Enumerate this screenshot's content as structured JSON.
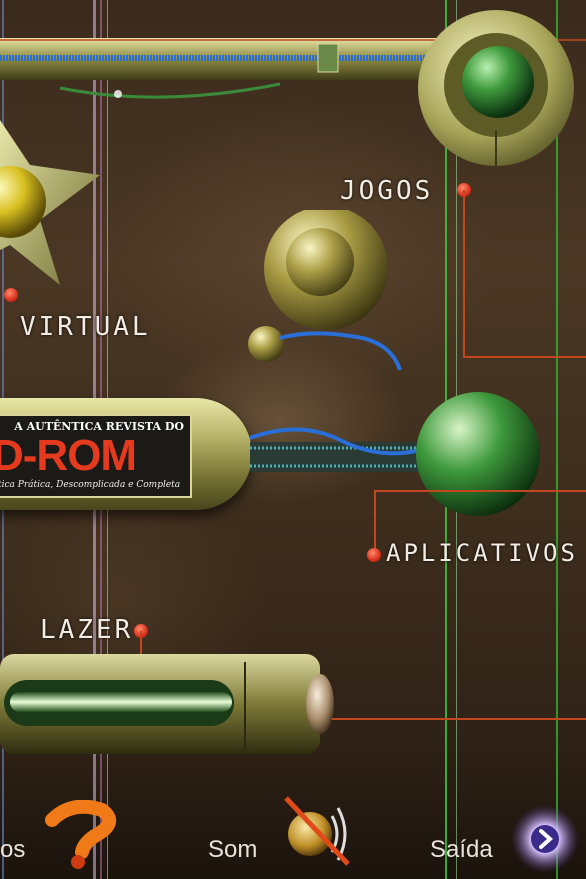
{
  "menu": {
    "jogos": "JOGOS",
    "virtual": "VIRTUAL",
    "aplicativos": "APLICATIVOS",
    "lazer": "LAZER"
  },
  "banner": {
    "top_line": "A AUTÊNTICA REVISTA DO",
    "main": "D-ROM",
    "sub_line": "tica Prática, Descomplicada e Completa"
  },
  "bottom_bar": {
    "help_label": "os",
    "sound_label": "Som",
    "exit_label": "Saída"
  },
  "colors": {
    "accent_line": "#c2471f",
    "dot": "#d8301c",
    "label": "#f1ede4"
  }
}
